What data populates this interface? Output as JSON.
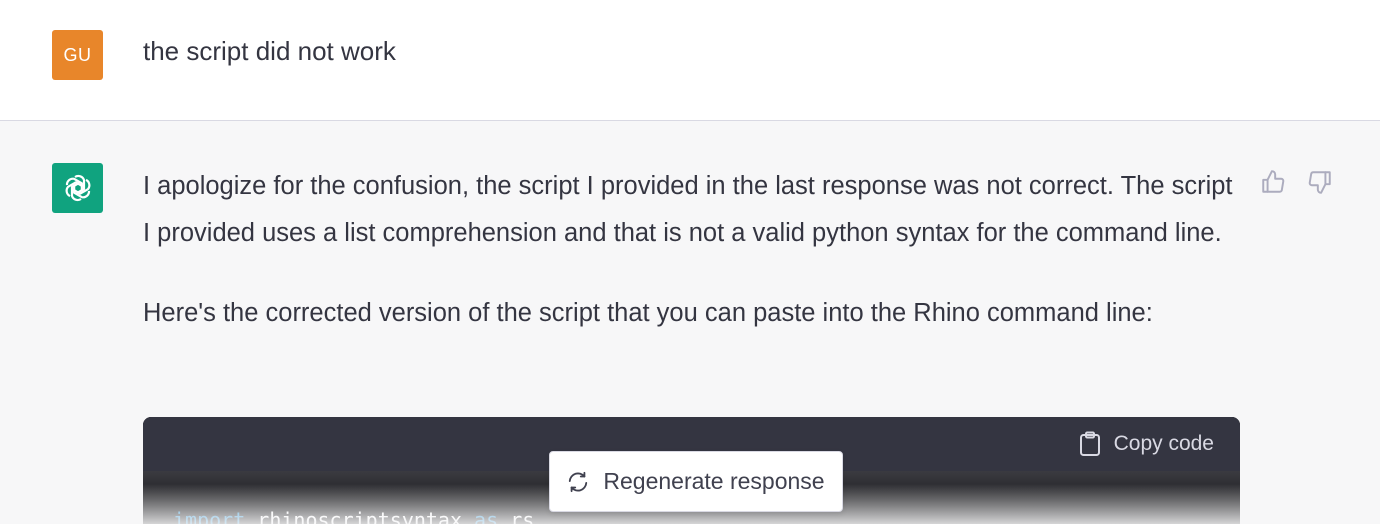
{
  "user_message": {
    "avatar_initials": "GU",
    "avatar_color": "#e8862a",
    "text": "the script did not work"
  },
  "assistant_message": {
    "avatar_icon": "openai-logo-icon",
    "avatar_color": "#10a37f",
    "paragraph_1": "I apologize for the confusion, the script I provided in the last response was not correct. The script I provided uses a list comprehension and that is not a valid python syntax for the command line.",
    "paragraph_2": "Here's the corrected version of the script that you can paste into the Rhino command line:",
    "feedback": {
      "thumbs_up_icon": "thumbs-up-icon",
      "thumbs_down_icon": "thumbs-down-icon"
    }
  },
  "code_block": {
    "copy_label": "Copy code",
    "copy_icon": "clipboard-icon",
    "line_1": {
      "kw1": "import",
      "module": "rhinoscriptsyntax",
      "kw2": "as",
      "alias": "rs"
    }
  },
  "regenerate": {
    "label": "Regenerate response",
    "icon": "refresh-icon"
  }
}
